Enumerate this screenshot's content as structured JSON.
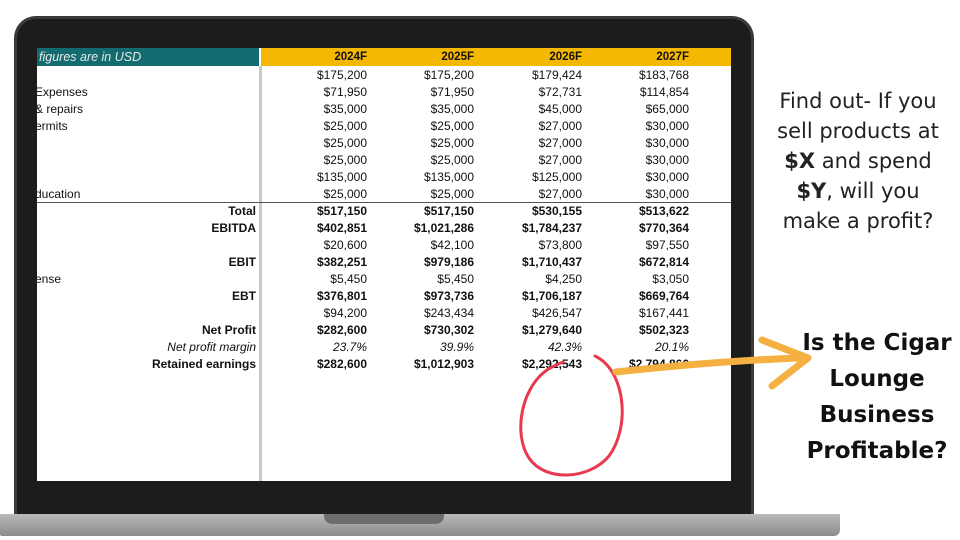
{
  "sheet": {
    "header_note": "figures are in USD",
    "columns": [
      "2024F",
      "2025F",
      "2026F",
      "2027F"
    ],
    "rows": [
      {
        "label": "",
        "values": [
          "$175,200",
          "$175,200",
          "$179,424",
          "$183,768"
        ],
        "style": "normal",
        "align": "left"
      },
      {
        "label": "Expenses",
        "values": [
          "$71,950",
          "$71,950",
          "$72,731",
          "$114,854"
        ],
        "style": "normal",
        "align": "left"
      },
      {
        "label": "& repairs",
        "values": [
          "$35,000",
          "$35,000",
          "$45,000",
          "$65,000"
        ],
        "style": "normal",
        "align": "left"
      },
      {
        "label": "ermits",
        "values": [
          "$25,000",
          "$25,000",
          "$27,000",
          "$30,000"
        ],
        "style": "normal",
        "align": "left"
      },
      {
        "label": "",
        "values": [
          "$25,000",
          "$25,000",
          "$27,000",
          "$30,000"
        ],
        "style": "normal",
        "align": "left"
      },
      {
        "label": "",
        "values": [
          "$25,000",
          "$25,000",
          "$27,000",
          "$30,000"
        ],
        "style": "normal",
        "align": "left"
      },
      {
        "label": "",
        "values": [
          "$135,000",
          "$135,000",
          "$125,000",
          "$30,000"
        ],
        "style": "normal",
        "align": "left"
      },
      {
        "label": "ducation",
        "values": [
          "$25,000",
          "$25,000",
          "$27,000",
          "$30,000"
        ],
        "style": "normal",
        "align": "left"
      },
      {
        "label": "Total",
        "values": [
          "$517,150",
          "$517,150",
          "$530,155",
          "$513,622"
        ],
        "style": "bold",
        "align": "right"
      },
      {
        "label": "EBITDA",
        "values": [
          "$402,851",
          "$1,021,286",
          "$1,784,237",
          "$770,364"
        ],
        "style": "bold",
        "align": "right"
      },
      {
        "label": "",
        "values": [
          "$20,600",
          "$42,100",
          "$73,800",
          "$97,550"
        ],
        "style": "normal",
        "align": "left"
      },
      {
        "label": "EBIT",
        "values": [
          "$382,251",
          "$979,186",
          "$1,710,437",
          "$672,814"
        ],
        "style": "bold",
        "align": "right"
      },
      {
        "label": "ense",
        "values": [
          "$5,450",
          "$5,450",
          "$4,250",
          "$3,050"
        ],
        "style": "normal",
        "align": "left"
      },
      {
        "label": "EBT",
        "values": [
          "$376,801",
          "$973,736",
          "$1,706,187",
          "$669,764"
        ],
        "style": "bold",
        "align": "right"
      },
      {
        "label": "",
        "values": [
          "$94,200",
          "$243,434",
          "$426,547",
          "$167,441"
        ],
        "style": "normal",
        "align": "left"
      },
      {
        "label": "Net Profit",
        "values": [
          "$282,600",
          "$730,302",
          "$1,279,640",
          "$502,323"
        ],
        "style": "bold",
        "align": "right"
      },
      {
        "label": "Net profit margin",
        "values": [
          "23.7%",
          "39.9%",
          "42.3%",
          "20.1%"
        ],
        "style": "italic",
        "align": "right"
      },
      {
        "label": "Retained earnings",
        "values": [
          "$282,600",
          "$1,012,903",
          "$2,292,543",
          "$2,794,866"
        ],
        "style": "bold",
        "align": "right"
      }
    ]
  },
  "annotation": {
    "circle_color": "#e8394f",
    "arrow_color": "#f4b041"
  },
  "side_text": {
    "find_out_parts": [
      "Find out- If you sell products at ",
      "$X",
      " and spend ",
      "$Y",
      ", will you make a profit?"
    ],
    "headline": "Is the Cigar Lounge Business Profitable?"
  }
}
